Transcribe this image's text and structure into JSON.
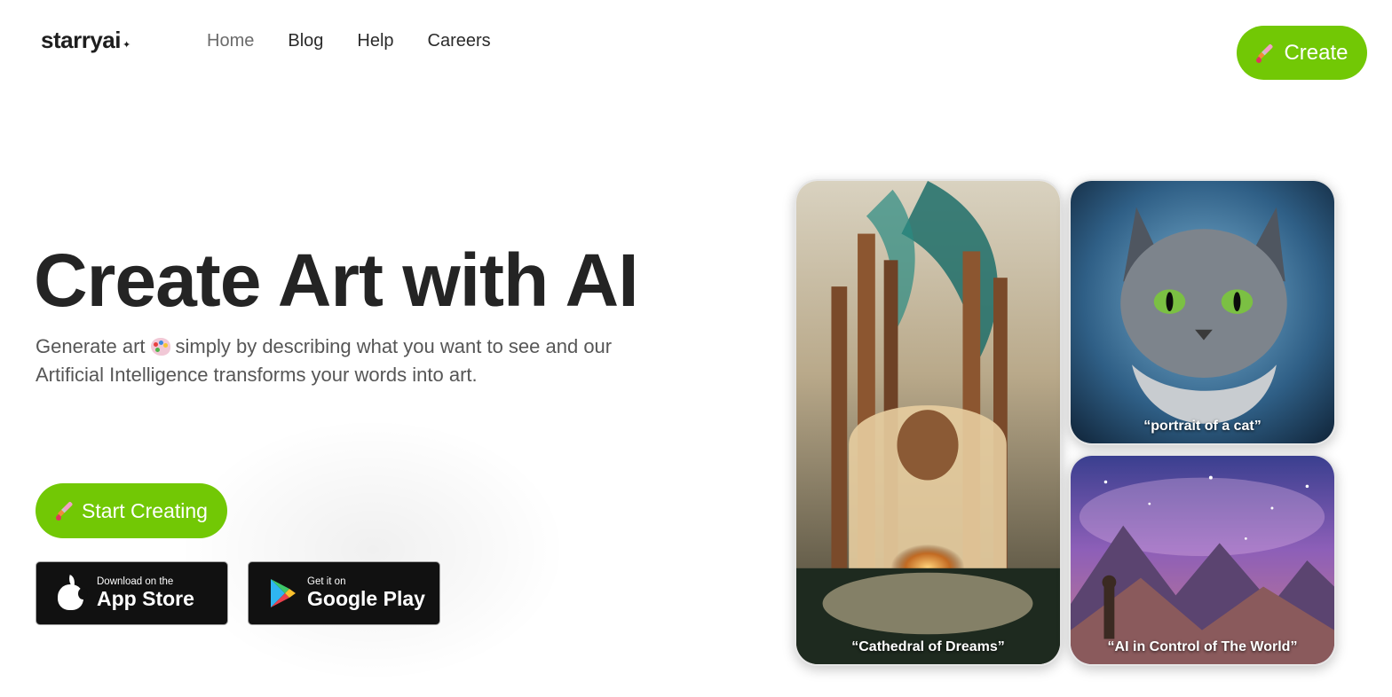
{
  "header": {
    "logo": "starryai",
    "logo_mark": "✦",
    "nav": [
      {
        "label": "Home",
        "active": true
      },
      {
        "label": "Blog",
        "active": false
      },
      {
        "label": "Help",
        "active": false
      },
      {
        "label": "Careers",
        "active": false
      }
    ],
    "create_button": {
      "label": "Create",
      "icon": "paintbrush-icon"
    }
  },
  "hero": {
    "title": "Create Art with AI",
    "subtitle_before": "Generate art",
    "subtitle_icon": "artist-palette-icon",
    "subtitle_after": "simply by describing what you want to see and our Artificial Intelligence transforms your words into art.",
    "start_button": {
      "label": "Start Creating",
      "icon": "paintbrush-icon"
    },
    "app_store": {
      "small": "Download on the",
      "big": "App Store",
      "icon": "apple-icon"
    },
    "google_play": {
      "small": "Get it on",
      "big": "Google Play",
      "icon": "google-play-icon"
    }
  },
  "gallery": [
    {
      "caption": "“Cathedral of Dreams”"
    },
    {
      "caption": "“portrait of a cat”"
    },
    {
      "caption": "“AI in Control of The World”"
    }
  ],
  "colors": {
    "accent_green": "#72c805",
    "text_dark": "#242424",
    "store_button_bg": "#111111"
  }
}
